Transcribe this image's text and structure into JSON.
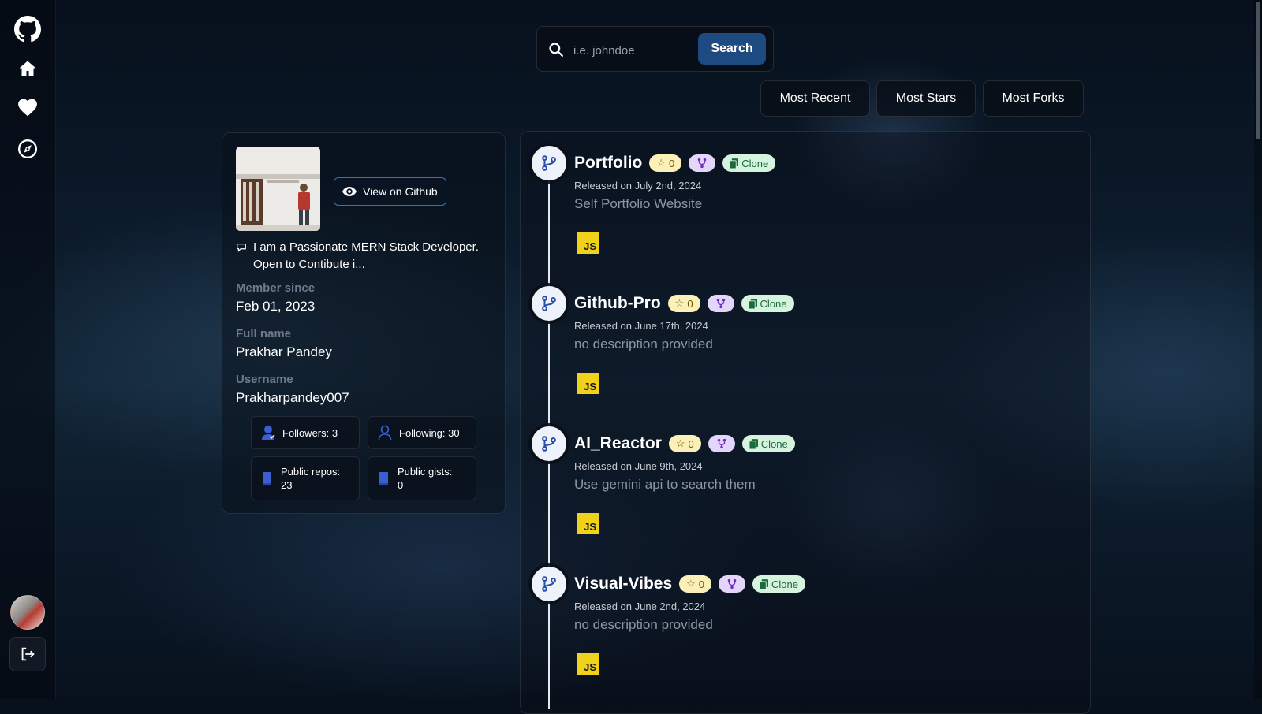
{
  "sidebar": {
    "icons": [
      "github-logo-icon",
      "home-icon",
      "heart-icon",
      "compass-icon"
    ],
    "user_avatar": "avatar",
    "logout": "logout-icon"
  },
  "search": {
    "placeholder": "i.e. johndoe",
    "value": "",
    "button_label": "Search"
  },
  "sort": {
    "buttons": [
      "Most Recent",
      "Most Stars",
      "Most Forks"
    ]
  },
  "profile": {
    "view_button_label": "View on Github",
    "bio_line1": "I am a Passionate MERN Stack Developer.",
    "bio_line2": "Open to Contibute i...",
    "member_since_label": "Member since",
    "member_since_value": "Feb 01, 2023",
    "full_name_label": "Full name",
    "full_name_value": "Prakhar Pandey",
    "username_label": "Username",
    "username_value": "Prakharpandey007",
    "stats": {
      "followers": "Followers: 3",
      "following": "Following: 30",
      "public_repos_line1": "Public repos:",
      "public_repos_line2": "23",
      "public_gists_line1": "Public gists:",
      "public_gists_line2": "0"
    }
  },
  "repos": [
    {
      "name": "Portfolio",
      "stars": "0",
      "clone_label": "Clone",
      "released": "Released on July 2nd, 2024",
      "description": "Self Portfolio Website",
      "language": "JS"
    },
    {
      "name": "Github-Pro",
      "stars": "0",
      "clone_label": "Clone",
      "released": "Released on June 17th, 2024",
      "description": "no description provided",
      "language": "JS"
    },
    {
      "name": "AI_Reactor",
      "stars": "0",
      "clone_label": "Clone",
      "released": "Released on June 9th, 2024",
      "description": "Use gemini api to search them",
      "language": "JS"
    },
    {
      "name": "Visual-Vibes",
      "stars": "0",
      "clone_label": "Clone",
      "released": "Released on June 2nd, 2024",
      "description": "no description provided",
      "language": "JS"
    }
  ],
  "colors": {
    "accent": "#1d4a80",
    "star_badge": "#fbf0b8",
    "fork_badge": "#e4d6fb",
    "clone_badge": "#d5f3df",
    "js_badge": "#f1d21a"
  }
}
